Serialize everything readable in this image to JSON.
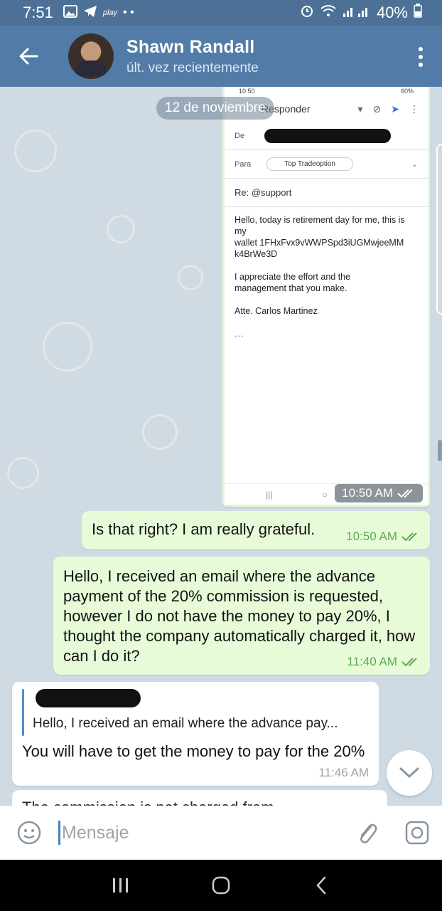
{
  "status_bar": {
    "time": "7:51",
    "app_small": "play",
    "dots": "• •",
    "battery": "40%"
  },
  "header": {
    "name": "Shawn Randall",
    "status": "últ. vez recientemente"
  },
  "chat": {
    "date": "12 de noviembre",
    "image_message": {
      "time": "10:50 AM",
      "mini_status_time": "10:50",
      "mini_status_battery": "60%",
      "reply_title": "Responder",
      "from_label": "De",
      "to_label": "Para",
      "to_chip": "Top Tradeoption",
      "subject": "Re: @support",
      "body_p1": "Hello, today is retirement day for me, this is my\nwallet 1FHxFvx9vWWPSpd3iUGMwjeeMM\nk4BrWe3D",
      "body_p2": "I appreciate the effort and the\nmanagement that you make.",
      "body_p3": "Atte. Carlos Martinez",
      "body_dots": "..."
    },
    "messages": [
      {
        "text": "Is that right? I am really grateful.",
        "time": "10:50 AM"
      },
      {
        "text": "Hello, I received an email where the advance payment of the 20% commission is requested, however I do not have the money to pay 20%, I thought the company automatically charged it, how can I do it?",
        "time": "11:40 AM"
      },
      {
        "reply_quote": "Hello, I received an email where the advance pay...",
        "text": "You will have to get the money to pay for the 20%",
        "time": "11:46 AM"
      },
      {
        "text": "The commission is not charged from..."
      }
    ]
  },
  "input": {
    "placeholder": "Mensaje"
  },
  "colors": {
    "header": "#527ca7",
    "outgoing": "#e7fbd8",
    "incoming": "#ffffff",
    "check": "#5daa4d"
  }
}
